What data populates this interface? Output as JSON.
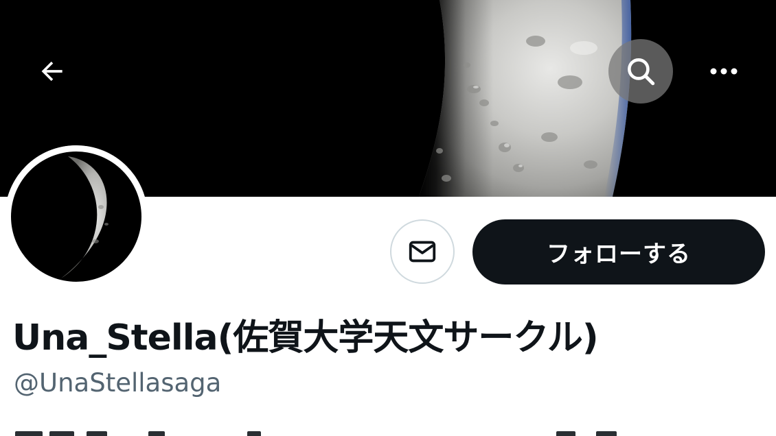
{
  "header": {
    "back_icon": "arrow-left-icon",
    "search_icon": "search-icon",
    "more_icon": "more-horizontal-icon"
  },
  "banner": {
    "subject": "moon-crescent"
  },
  "profile": {
    "display_name": "Una_Stella(佐賀大学天文サークル)",
    "handle": "@UnaStellasaga",
    "dm_icon": "mail-icon",
    "follow_label": "フォローする"
  },
  "colors": {
    "follow_bg": "#0f1419",
    "follow_text": "#ffffff",
    "handle_text": "#536471",
    "name_text": "#0f1419",
    "border": "#cfd9de"
  }
}
